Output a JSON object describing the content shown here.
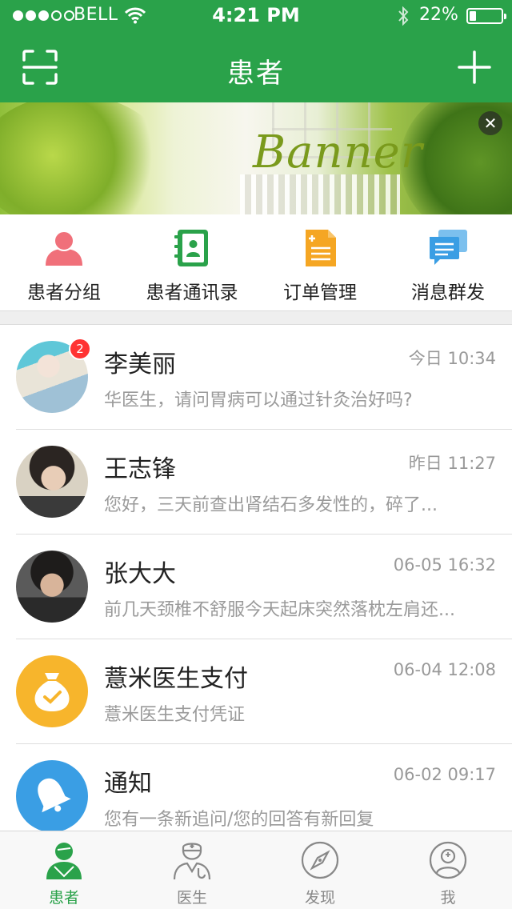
{
  "status_bar": {
    "signal_bars_on": 3,
    "signal_bars_total": 5,
    "carrier": "BELL",
    "time": "4:21 PM",
    "battery_percent": "22%",
    "battery_level": 0.22
  },
  "nav": {
    "title": "患者",
    "left_icon": "scan-icon",
    "right_icon": "plus-icon"
  },
  "banner": {
    "text": "Banner",
    "close_icon": "close-icon"
  },
  "quick_actions": [
    {
      "label": "患者分组",
      "icon": "patient-group-icon",
      "color": "#f0707a"
    },
    {
      "label": "患者通讯录",
      "icon": "contacts-book-icon",
      "color": "#2aa24a"
    },
    {
      "label": "订单管理",
      "icon": "order-document-icon",
      "color": "#f5a623"
    },
    {
      "label": "消息群发",
      "icon": "chat-bubbles-icon",
      "color": "#3a9ee4"
    }
  ],
  "conversations": [
    {
      "name": "李美丽",
      "time": "今日 10:34",
      "preview": "华医生，请问胃病可以通过针灸治好吗?",
      "badge": "2",
      "avatar": "photo-avatar"
    },
    {
      "name": "王志锋",
      "time": "昨日 11:27",
      "preview": "您好，三天前查出肾结石多发性的，碎了...",
      "badge": "",
      "avatar": "photo-avatar"
    },
    {
      "name": "张大大",
      "time": "06-05 16:32",
      "preview": "前几天颈椎不舒服今天起床突然落枕左肩还...",
      "badge": "",
      "avatar": "photo-avatar"
    },
    {
      "name": "薏米医生支付",
      "time": "06-04 12:08",
      "preview": "薏米医生支付凭证",
      "badge": "",
      "avatar": "money-bag-icon",
      "avatar_color": "#f7b52c"
    },
    {
      "name": "通知",
      "time": "06-02 09:17",
      "preview": "您有一条新追问/您的回答有新回复",
      "badge": "",
      "avatar": "bell-icon",
      "avatar_color": "#3a9ee4"
    }
  ],
  "tabs": [
    {
      "label": "患者",
      "icon": "patient-icon",
      "active": true
    },
    {
      "label": "医生",
      "icon": "doctor-icon",
      "active": false
    },
    {
      "label": "发现",
      "icon": "compass-icon",
      "active": false
    },
    {
      "label": "我",
      "icon": "profile-icon",
      "active": false
    }
  ],
  "colors": {
    "brand_green": "#2aa24a",
    "badge_red": "#ff3333",
    "text_gray": "#9a9a9a"
  }
}
